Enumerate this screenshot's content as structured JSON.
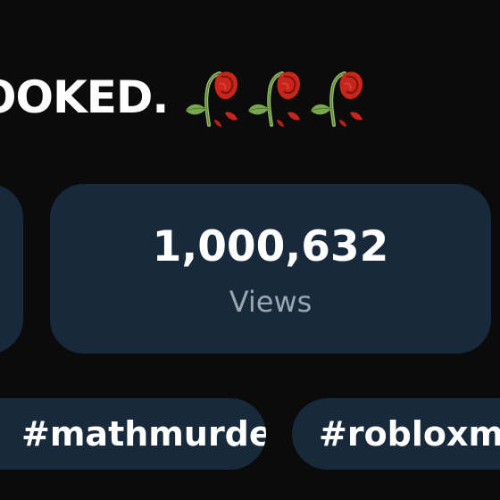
{
  "headline": {
    "text": "OOKED.",
    "icons": [
      "wilted-rose-icon",
      "wilted-rose-icon",
      "wilted-rose-icon"
    ]
  },
  "stats": {
    "views_value": "1,000,632",
    "views_label": "Views"
  },
  "hashtags": [
    "#mathmurder",
    "#robloxma"
  ],
  "colors": {
    "background": "#0b0b0c",
    "card": "#17293a",
    "text_primary": "#ffffff",
    "text_secondary": "#9aa6b2",
    "rose_red": "#c8261a"
  }
}
